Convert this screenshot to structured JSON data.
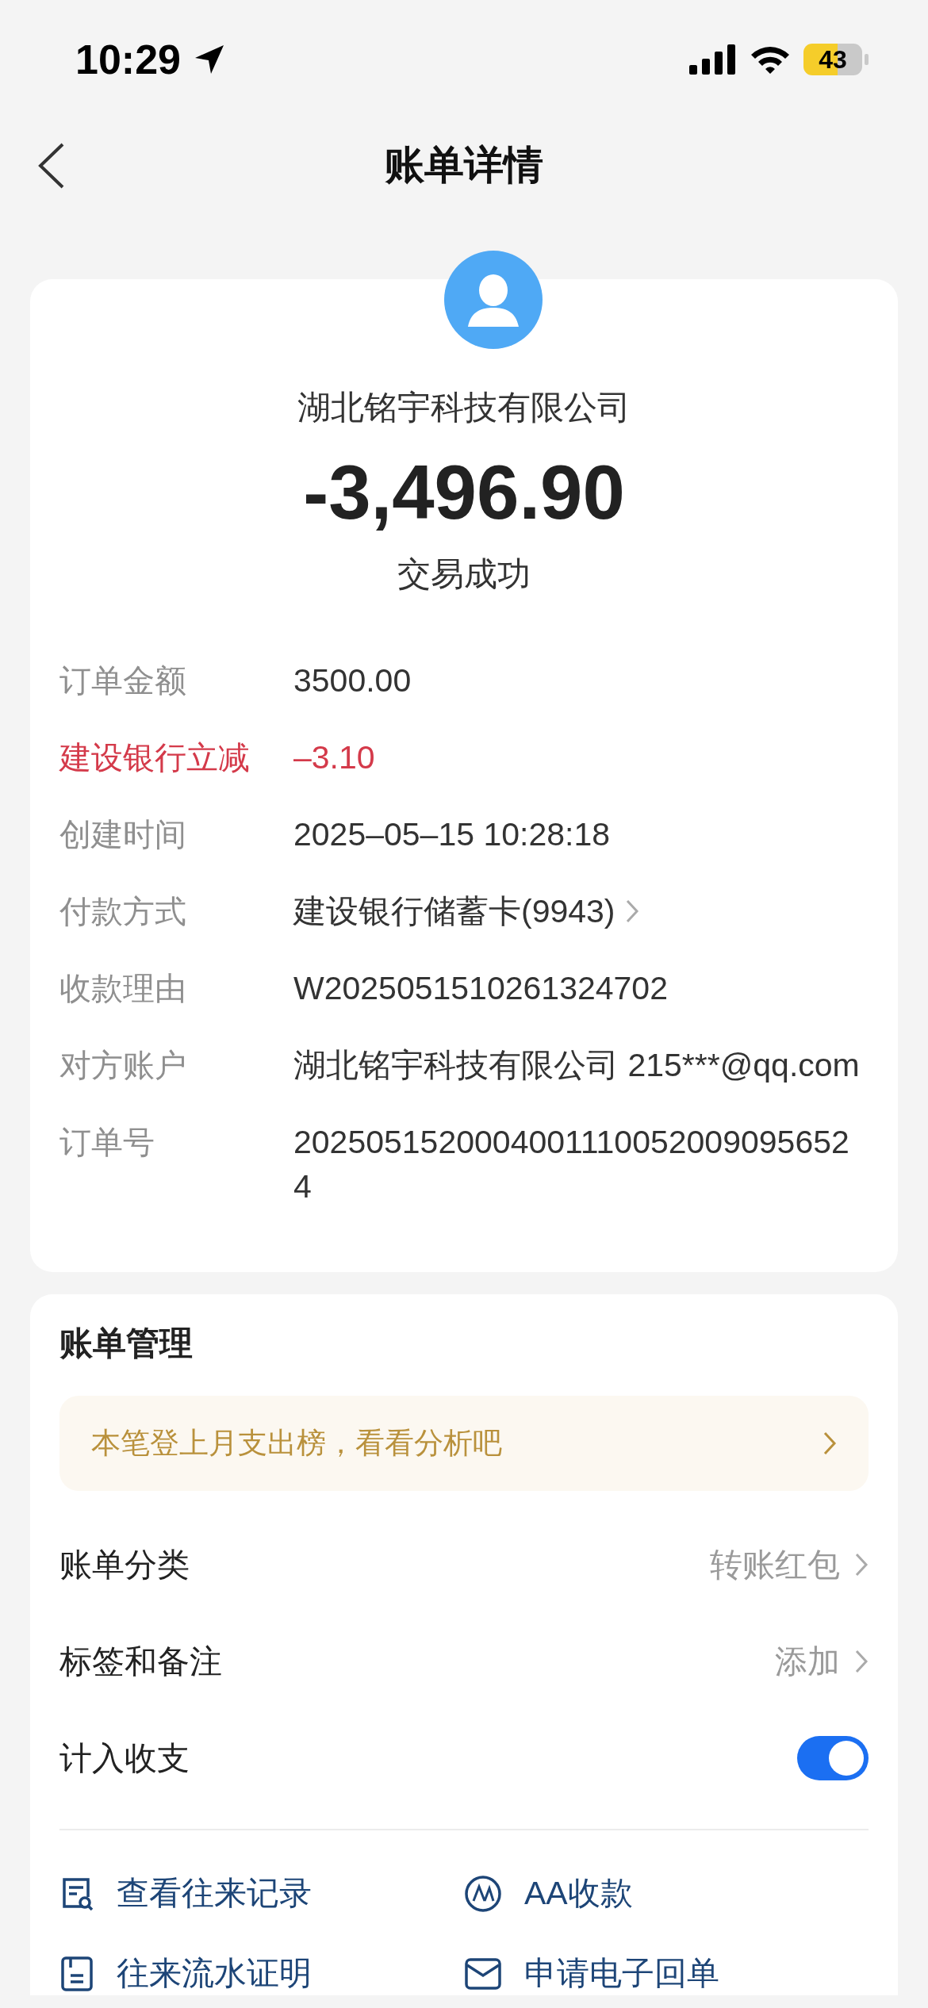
{
  "status_bar": {
    "time": "10:29",
    "battery": "43"
  },
  "nav": {
    "title": "账单详情"
  },
  "summary": {
    "payee": "湖北铭宇科技有限公司",
    "amount": "-3,496.90",
    "status": "交易成功"
  },
  "details": [
    {
      "label": "订单金额",
      "value": "3500.00",
      "kind": "plain",
      "chevron": false
    },
    {
      "label": "建设银行立减",
      "value": "–3.10",
      "kind": "discount",
      "chevron": false
    },
    {
      "label": "创建时间",
      "value": "2025–05–15 10:28:18",
      "kind": "plain",
      "chevron": false
    },
    {
      "label": "付款方式",
      "value": "建设银行储蓄卡(9943)",
      "kind": "plain",
      "chevron": true
    },
    {
      "label": "收款理由",
      "value": "W2025051510261324702",
      "kind": "plain",
      "chevron": false
    },
    {
      "label": "对方账户",
      "value": "湖北铭宇科技有限公司 215***@qq.com",
      "kind": "plain",
      "chevron": false
    },
    {
      "label": "订单号",
      "value": "2025051520004001110052009095652 4",
      "kind": "plain",
      "chevron": false
    }
  ],
  "management": {
    "title": "账单管理",
    "banner": "本笔登上月支出榜，看看分析吧",
    "rows": [
      {
        "kind": "link",
        "label": "账单分类",
        "value": "转账红包"
      },
      {
        "kind": "link",
        "label": "标签和备注",
        "value": "添加"
      },
      {
        "kind": "toggle",
        "label": "计入收支",
        "on": true
      }
    ],
    "actions": [
      {
        "kind": "records",
        "label": "查看往来记录"
      },
      {
        "kind": "aa",
        "label": "AA收款"
      },
      {
        "kind": "statement",
        "label": "往来流水证明"
      },
      {
        "kind": "receipt",
        "label": "申请电子回单"
      }
    ]
  }
}
